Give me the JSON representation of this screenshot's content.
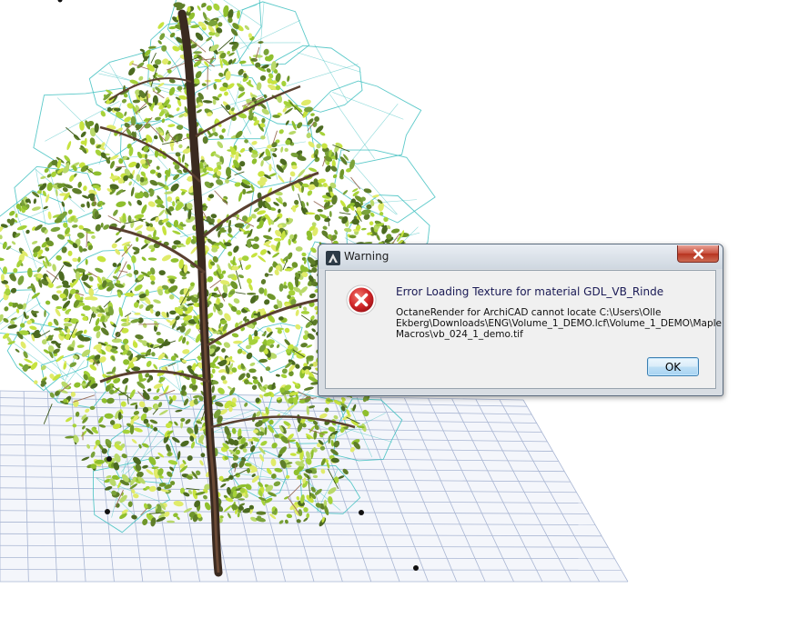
{
  "dialog": {
    "title": "Warning",
    "message": "Error Loading Texture for material GDL_VB_Rinde",
    "detail": "OctaneRender for ArchiCAD cannot locate C:\\Users\\Olle\nEkberg\\Downloads\\ENG\\Volume_1_DEMO.lcf\\Volume_1_DEMO\\Maple\nMacros\\vb_024_1_demo.tif",
    "ok_label": "OK"
  },
  "colors": {
    "grid_line": "#a9b6d3",
    "foliage_light": "#a6d23a",
    "foliage_dark": "#4c6a21",
    "wireframe": "#3ec0c0",
    "trunk": "#3a2a20",
    "error_red": "#c3191b"
  },
  "icons": {
    "app": "archicad-icon",
    "error": "error-icon",
    "close": "close-icon"
  }
}
